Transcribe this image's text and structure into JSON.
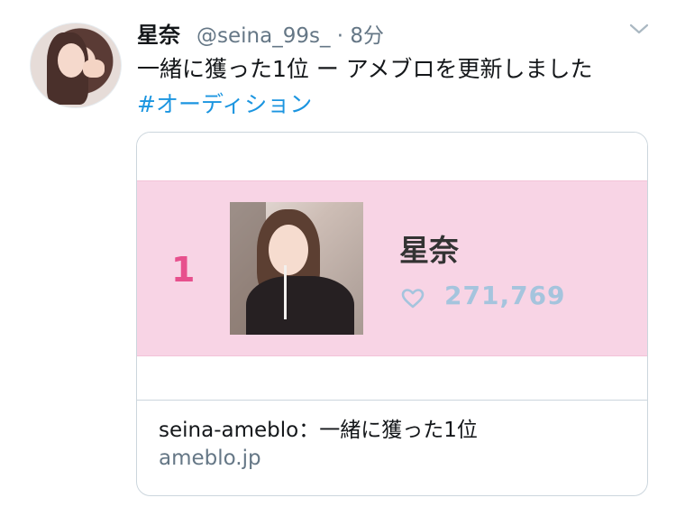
{
  "tweet": {
    "display_name": "星奈",
    "handle": "@seina_99s_",
    "time": "· 8分",
    "text": "一緒に獲った1位 ー アメブロを更新しました",
    "hashtag": "#オーディション"
  },
  "card": {
    "rank": "1",
    "rank_name": "星奈",
    "likes": "271,769",
    "title": "seina-ameblo：一緒に獲った1位",
    "domain": "ameblo.jp"
  },
  "colors": {
    "link": "#1b95e0",
    "secondary_text": "#657786",
    "rank_pink": "#e7508d",
    "row_pink": "#f8d4e5",
    "likes_blue": "#a5c4dd"
  },
  "icons": [
    "chevron-down-icon",
    "heart-icon"
  ]
}
